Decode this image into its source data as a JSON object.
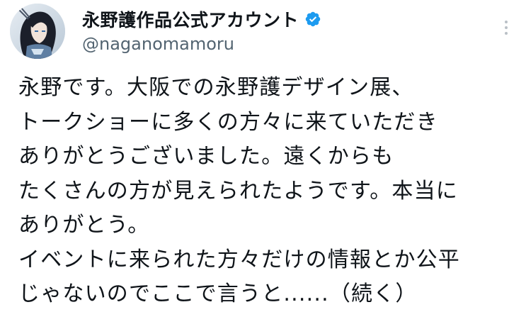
{
  "tweet": {
    "author": {
      "display_name": "永野護作品公式アカウント",
      "handle": "@naganomamoru",
      "verified": true
    },
    "text_lines": [
      "永野です。大阪での永野護デザイン展、",
      "トークショーに多くの方々に来ていただき",
      "ありがとうございました。遠くからも",
      "たくさんの方が見えられたようです。本当に",
      "ありがとう。",
      "イベントに来られた方々だけの情報とか公平",
      "じゃないのでここで言うと......（続く）"
    ]
  },
  "icons": {
    "verified": "verified-badge-icon",
    "more": "more-options-icon"
  },
  "colors": {
    "verified_badge": "#1d9bf0",
    "text_primary": "#0f1419",
    "text_secondary": "#536471"
  }
}
